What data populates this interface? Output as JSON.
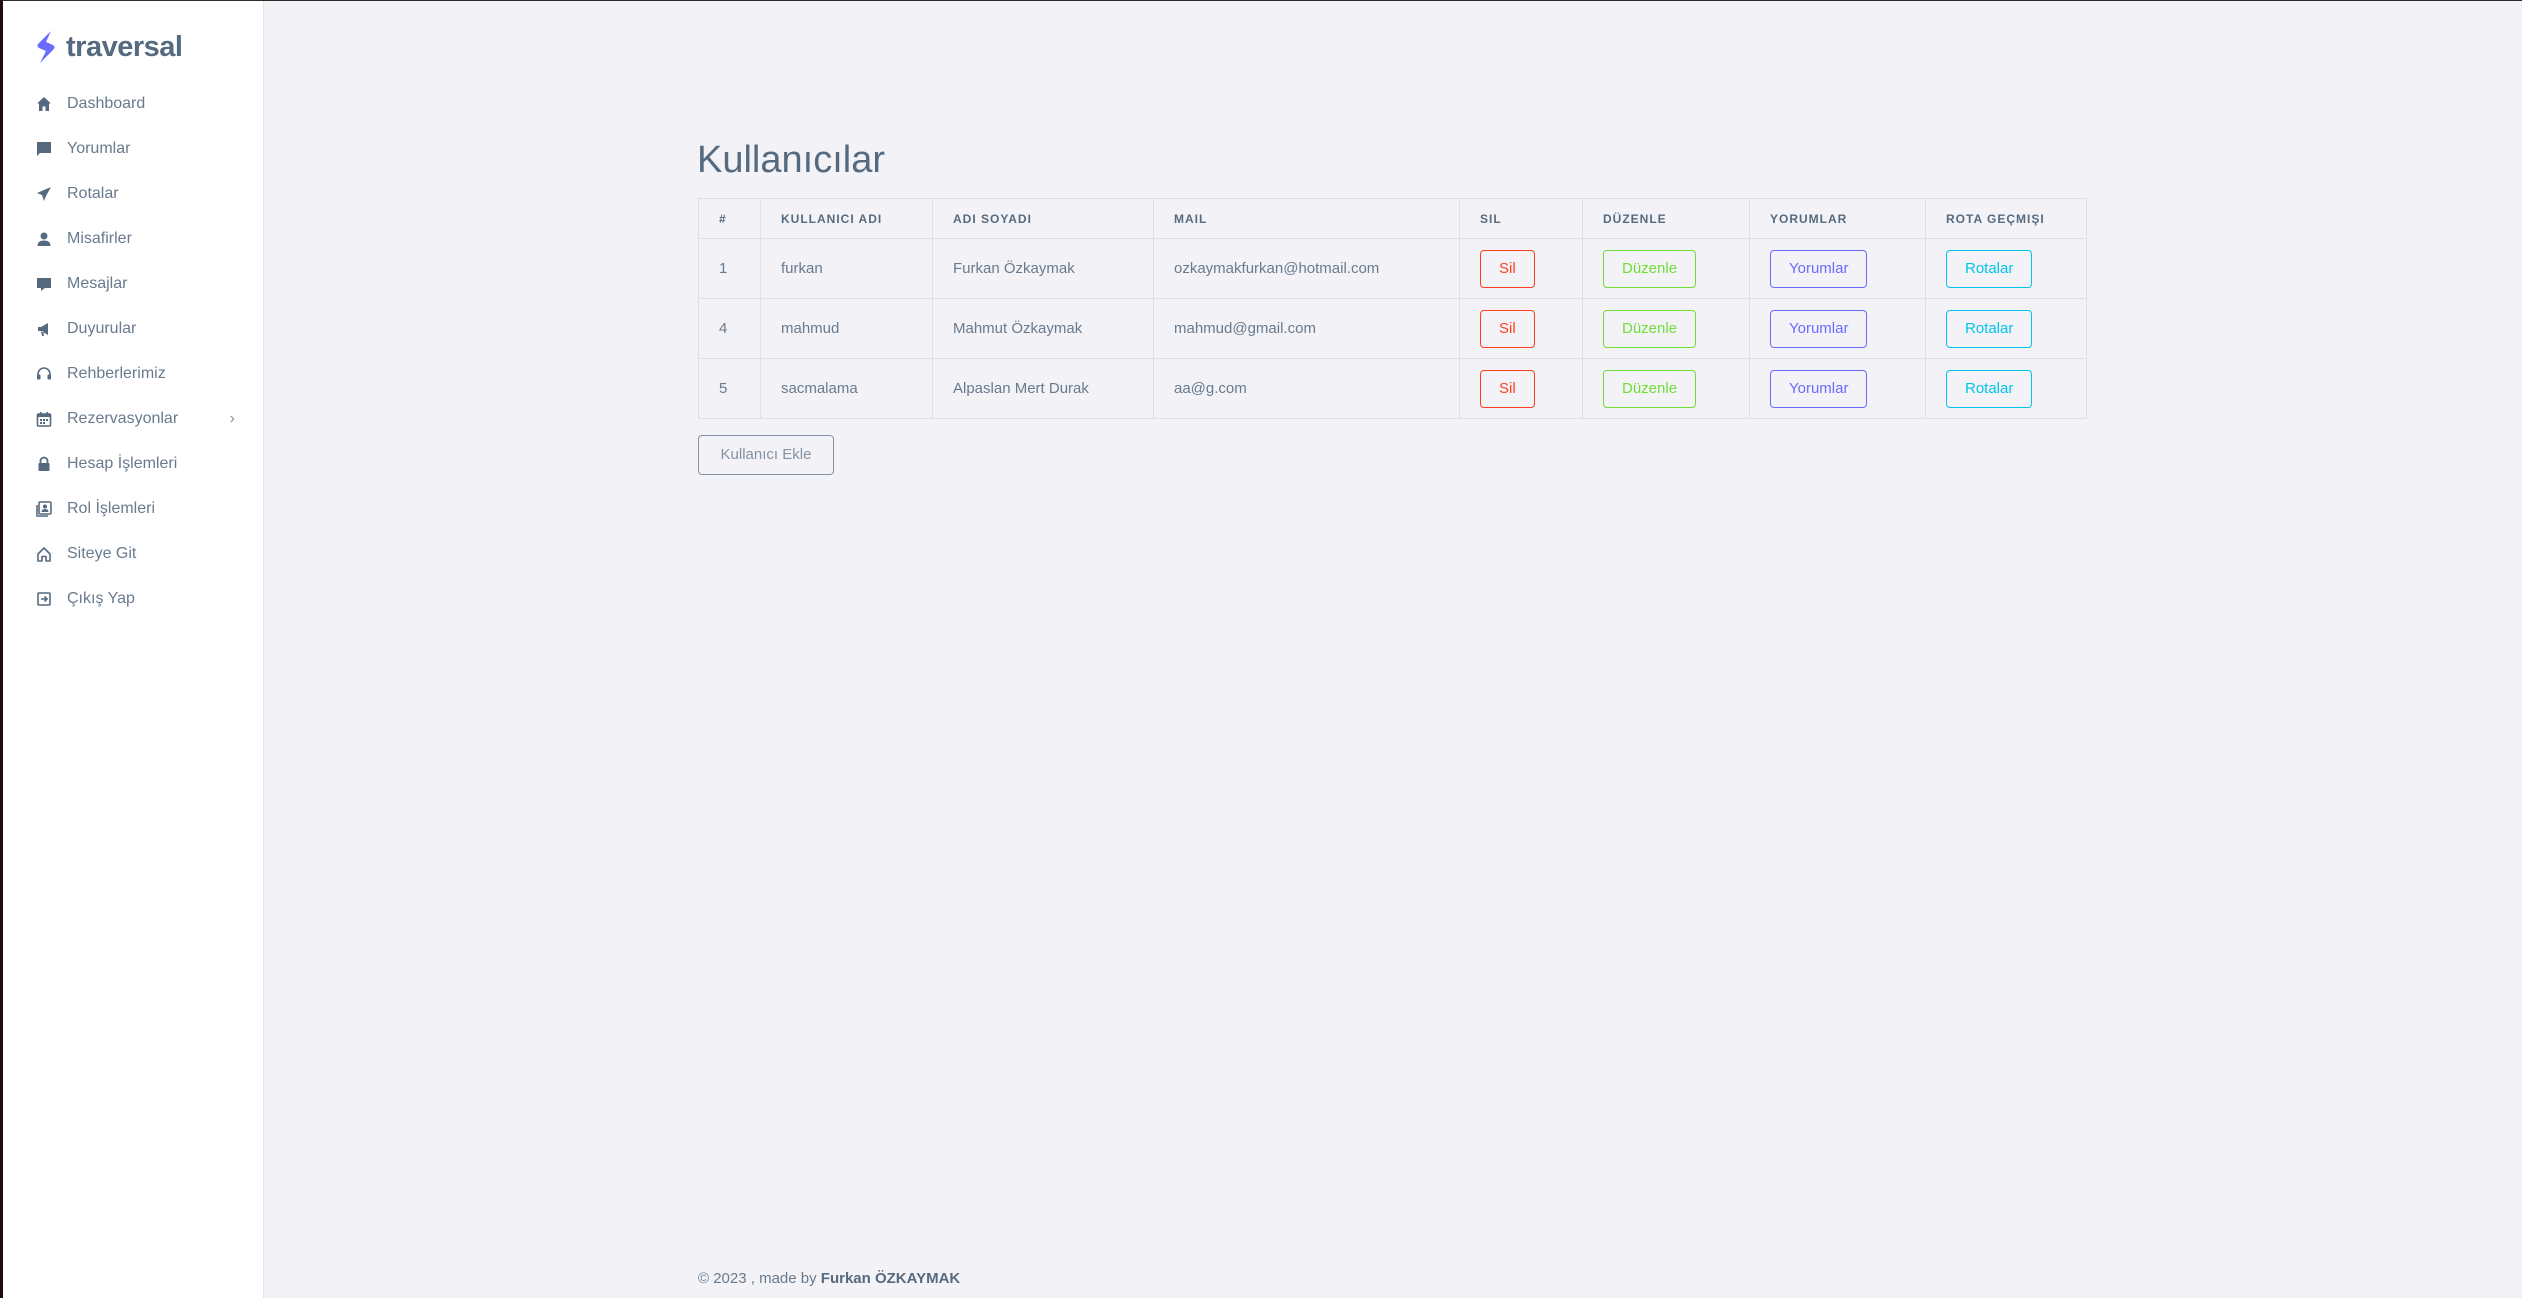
{
  "brand": {
    "name": "traversal",
    "accent": "#696cff"
  },
  "sidebar": {
    "items": [
      {
        "label": "Dashboard",
        "icon": "home-icon"
      },
      {
        "label": "Yorumlar",
        "icon": "chat-icon"
      },
      {
        "label": "Rotalar",
        "icon": "plane-icon"
      },
      {
        "label": "Misafirler",
        "icon": "user-icon"
      },
      {
        "label": "Mesajlar",
        "icon": "message-icon"
      },
      {
        "label": "Duyurular",
        "icon": "megaphone-icon"
      },
      {
        "label": "Rehberlerimiz",
        "icon": "headset-icon"
      },
      {
        "label": "Rezervasyonlar",
        "icon": "calendar-icon"
      },
      {
        "label": "Hesap İşlemleri",
        "icon": "lock-icon"
      },
      {
        "label": "Rol İşlemleri",
        "icon": "id-card-icon"
      },
      {
        "label": "Siteye Git",
        "icon": "house-outline-icon"
      },
      {
        "label": "Çıkış Yap",
        "icon": "logout-icon"
      }
    ]
  },
  "main": {
    "title": "Kullanıcılar",
    "table": {
      "headers": [
        "#",
        "KULLANICI ADI",
        "ADI SOYADI",
        "MAIL",
        "SIL",
        "DÜZENLE",
        "YORUMLAR",
        "ROTA GEÇMIŞI"
      ],
      "rows": [
        {
          "id": "1",
          "username": "furkan",
          "fullname": "Furkan Özkaymak",
          "mail": "ozkaymakfurkan@hotmail.com"
        },
        {
          "id": "4",
          "username": "mahmud",
          "fullname": "Mahmut Özkaymak",
          "mail": "mahmud@gmail.com"
        },
        {
          "id": "5",
          "username": "sacmalama",
          "fullname": "Alpaslan Mert Durak",
          "mail": "aa@g.com"
        }
      ],
      "actions": {
        "delete": "Sil",
        "edit": "Düzenle",
        "comments": "Yorumlar",
        "routes": "Rotalar"
      }
    },
    "add_button": "Kullanıcı Ekle"
  },
  "footer": {
    "text": "© 2023 , made by ",
    "author": "Furkan ÖZKAYMAK"
  },
  "colors": {
    "danger": "#ff3e1d",
    "success": "#71dd37",
    "primary": "#696cff",
    "info": "#03c3ec",
    "secondary": "#8592a3"
  }
}
